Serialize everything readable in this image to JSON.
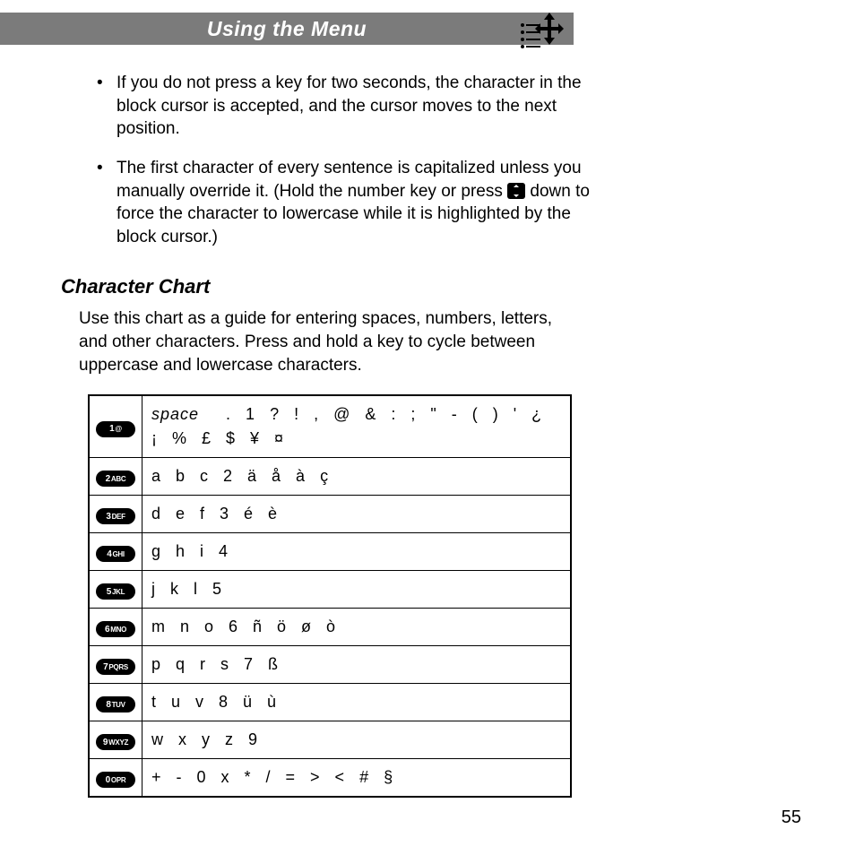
{
  "header": {
    "title": "Using the Menu"
  },
  "bullets": [
    {
      "text": "If you do not press a key for two seconds, the character in the block cursor is accepted, and the cursor moves to the next position."
    },
    {
      "pre": "The first character of every sentence is capitalized unless you manually override it. (Hold the number key or press ",
      "post": " down to force the character to lowercase while it is highlighted by the block cursor.)"
    }
  ],
  "section_title": "Character Chart",
  "intro": "Use this chart as a guide for entering spaces, numbers, letters, and other characters. Press and hold a key to cycle between uppercase and lowercase characters.",
  "rows": [
    {
      "num": "1",
      "lbl": "@",
      "prefix": "space",
      "chars": ". 1 ? ! , @ & : ; \" - ( ) ' ¿ ¡ % £ $ ¥ ¤"
    },
    {
      "num": "2",
      "lbl": "ABC",
      "chars": "a b c 2 ä å à   ç"
    },
    {
      "num": "3",
      "lbl": "DEF",
      "chars": "d e f 3   é è"
    },
    {
      "num": "4",
      "lbl": "GHI",
      "chars": "g h i 4"
    },
    {
      "num": "5",
      "lbl": "JKL",
      "chars": "j k l 5"
    },
    {
      "num": "6",
      "lbl": "MNO",
      "chars": "m n o 6 ñ ö ø ò"
    },
    {
      "num": "7",
      "lbl": "PQRS",
      "chars": "p q r s 7   ß"
    },
    {
      "num": "8",
      "lbl": "TUV",
      "chars": "t u v 8   ü ù"
    },
    {
      "num": "9",
      "lbl": "WXYZ",
      "chars": "w x y z 9"
    },
    {
      "num": "0",
      "lbl": "OPR",
      "chars": "+ - 0 x * / = > < # §"
    }
  ],
  "page_number": "55"
}
